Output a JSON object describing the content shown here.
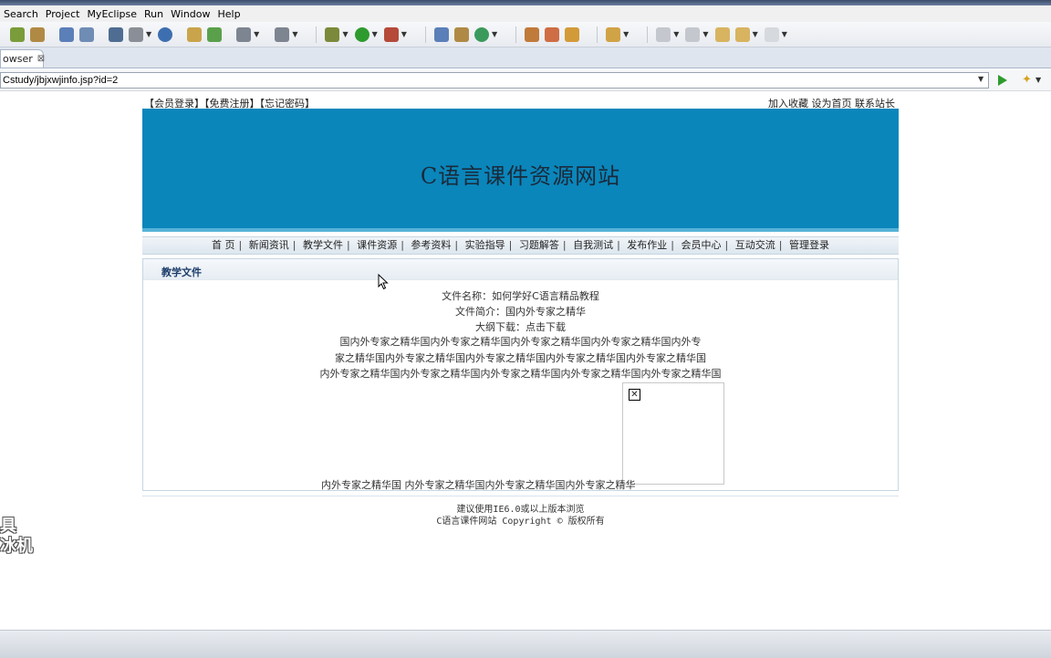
{
  "menubar": {
    "items": [
      "Search",
      "Project",
      "MyEclipse",
      "Run",
      "Window",
      "Help"
    ]
  },
  "tab": {
    "label": "owser",
    "close": "⊠"
  },
  "address": {
    "url": "Cstudy/jbjxwjinfo.jsp?id=2"
  },
  "topbar": {
    "member_links": "【会员登录】【免费注册】【忘记密码】",
    "site_links": "加入收藏  设为首页  联系站长"
  },
  "banner": {
    "title": "C语言课件资源网站"
  },
  "nav": {
    "items": [
      "首 页",
      "新闻资讯",
      "教学文件",
      "课件资源",
      "参考资料",
      "实验指导",
      "习题解答",
      "自我测试",
      "发布作业",
      "会员中心",
      "互动交流",
      "管理登录"
    ]
  },
  "section": {
    "title": "教学文件"
  },
  "file": {
    "name": "文件名称：如何学好C语言精品教程",
    "summary": "文件简介：国内外专家之精华",
    "download": "大纲下载：点击下载",
    "desc_lines": [
      "国内外专家之精华国内外专家之精华国内外专家之精华国内外专家之精华国内外专",
      "家之精华国内外专家之精华国内外专家之精华国内外专家之精华国内外专家之精华国",
      "内外专家之精华国内外专家之精华国内外专家之精华国内外专家之精华国内外专家之精华国"
    ],
    "last_line": "内外专家之精华国 内外专家之精华国内外专家之精华国内外专家之精华"
  },
  "footer": {
    "line1": "建议使用IE6.0或以上版本浏览",
    "line2": "C语言课件网站 Copyright © 版权所有"
  },
  "watermark": {
    "line1": "具",
    "line2": "冰机"
  },
  "icons": {
    "broken_image": "broken-image-icon",
    "go": "go-arrow-icon",
    "favorite": "star-icon"
  },
  "colors": {
    "banner": "#0a86bb",
    "banner_border": "#56b3d8",
    "section_title": "#1c3d6a"
  }
}
